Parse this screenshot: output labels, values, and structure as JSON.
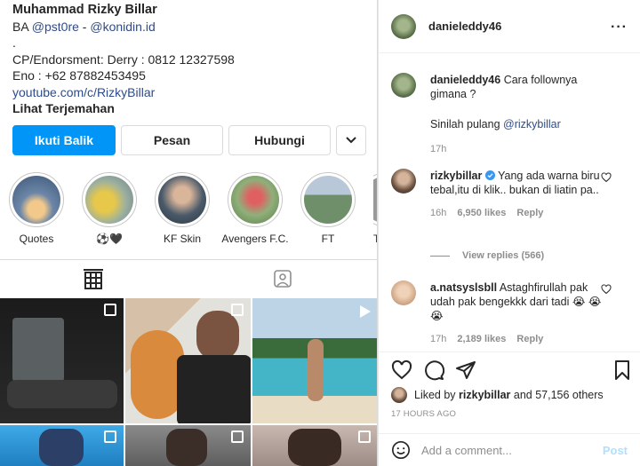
{
  "profile": {
    "name": "Muhammad Rizky Billar",
    "bio_lines": [
      {
        "prefix": "BA ",
        "link1": "@pst0re",
        "sep": " - ",
        "link2": "@konidin.id"
      },
      "."
    ],
    "cp": "CP/Endorsment: Derry : 0812 12327598",
    "eno": "Eno : +62 87882453495",
    "website": "youtube.com/c/RizkyBillar",
    "translate": "Lihat Terjemahan"
  },
  "buttons": {
    "follow_back": "Ikuti Balik",
    "message": "Pesan",
    "contact": "Hubungi",
    "dropdown_icon": "chevron-down-icon"
  },
  "highlights": [
    {
      "label": "Quotes",
      "color": "#6b86a8"
    },
    {
      "label": "⚽🖤",
      "color": "#c9a64a"
    },
    {
      "label": "KF Skin",
      "color": "#4a5a6a"
    },
    {
      "label": "Avengers F.C.",
      "color": "#9a6a5a"
    },
    {
      "label": "FT",
      "color": "#6f8f6a"
    },
    {
      "label": "To",
      "color": "#888888"
    }
  ],
  "post": {
    "author": "danieleddy46",
    "more_icon": "more-horizontal-icon"
  },
  "comments": [
    {
      "user": "danieleddy46",
      "text": "Cara follownya gimana ?",
      "reply_prefix": "Sinilah pulang ",
      "reply_mention": "@rizkybillar",
      "time": "17h"
    },
    {
      "user": "rizkybillar",
      "verified": true,
      "text": "Yang ada warna biru tebal,itu di klik.. bukan di liatin pa..",
      "time": "16h",
      "likes": "6,950 likes",
      "reply": "Reply",
      "view_replies": "View replies (566)"
    },
    {
      "user": "a.natsyslsbll",
      "text": "Astaghfirullah pak udah pak bengekkk dari tadi 😭 😭😭",
      "time": "17h",
      "likes": "2,189 likes",
      "reply": "Reply"
    }
  ],
  "liked_by": {
    "prefix": "Liked by ",
    "user": "rizkybillar",
    "suffix": " and 57,156 others"
  },
  "time_ago": "17 HOURS AGO",
  "add_comment": {
    "placeholder": "Add a comment...",
    "post_label": "Post"
  },
  "colors": {
    "accent": "#0095f6",
    "link": "#2f4b8a",
    "muted": "#8e8e8e"
  }
}
